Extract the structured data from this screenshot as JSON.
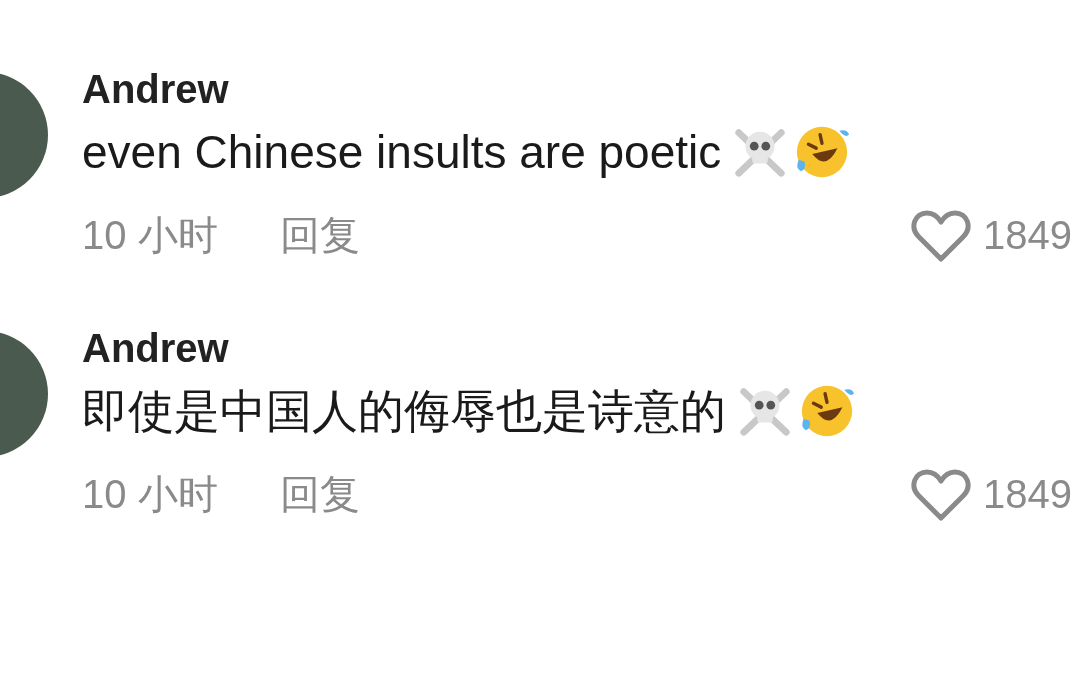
{
  "comments": [
    {
      "author": "Andrew",
      "text": "even Chinese insults are poetic",
      "time": "10 小时",
      "reply": "回复",
      "likes": "1849"
    },
    {
      "author": "Andrew",
      "text": "即使是中国人的侮辱也是诗意的",
      "time": "10 小时",
      "reply": "回复",
      "likes": "1849"
    }
  ]
}
